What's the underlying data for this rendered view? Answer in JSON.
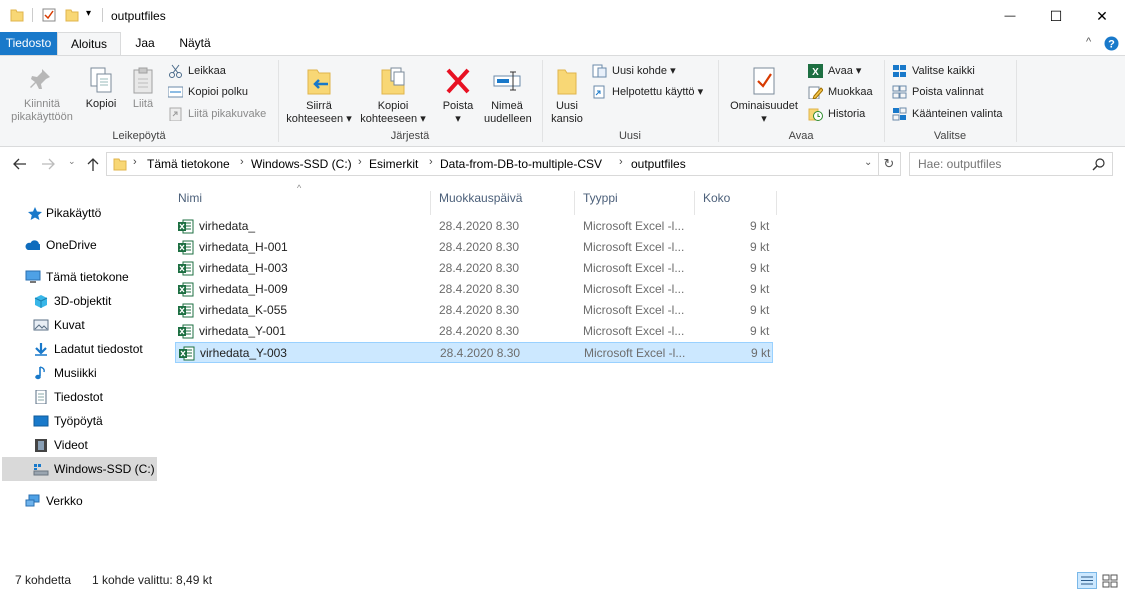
{
  "window": {
    "title": "outputfiles",
    "minimize": "—",
    "maximize": "☐",
    "close": "✕"
  },
  "ribbon_tabs": [
    "Tiedosto",
    "Aloitus",
    "Jaa",
    "Näytä"
  ],
  "ribbon": {
    "clipboard": {
      "label": "Leikepöytä",
      "pin": "Kiinnitä pikakäyttöön",
      "copy": "Kopioi",
      "paste": "Liitä",
      "cut": "Leikkaa",
      "copy_path": "Kopioi polku",
      "paste_shortcut": "Liitä pikakuvake"
    },
    "organize": {
      "label": "Järjestä",
      "move_to": "Siirrä kohteeseen",
      "copy_to": "Kopioi kohteeseen",
      "delete": "Poista",
      "rename": "Nimeä uudelleen"
    },
    "new": {
      "label": "Uusi",
      "new_folder": "Uusi kansio",
      "new_item": "Uusi kohde",
      "easy_access": "Helpotettu käyttö"
    },
    "open": {
      "label": "Avaa",
      "properties": "Ominaisuudet",
      "open": "Avaa",
      "edit": "Muokkaa",
      "history": "Historia"
    },
    "select": {
      "label": "Valitse",
      "select_all": "Valitse kaikki",
      "select_none": "Poista valinnat",
      "invert": "Käänteinen valinta"
    }
  },
  "address": {
    "crumbs": [
      "Tämä tietokone",
      "Windows-SSD (C:)",
      "Esimerkit",
      "Data-from-DB-to-multiple-CSV",
      "outputfiles"
    ],
    "search_placeholder": "Hae: outputfiles"
  },
  "nav_pane": {
    "quick_access": "Pikakäyttö",
    "onedrive": "OneDrive",
    "this_pc": "Tämä tietokone",
    "items": [
      "3D-objektit",
      "Kuvat",
      "Ladatut tiedostot",
      "Musiikki",
      "Tiedostot",
      "Työpöytä",
      "Videot",
      "Windows-SSD (C:)"
    ],
    "network": "Verkko"
  },
  "columns": [
    "Nimi",
    "Muokkauspäivä",
    "Tyyppi",
    "Koko"
  ],
  "files": [
    {
      "name": "virhedata_",
      "date": "28.4.2020 8.30",
      "type": "Microsoft Excel -l...",
      "size": "9 kt"
    },
    {
      "name": "virhedata_H-001",
      "date": "28.4.2020 8.30",
      "type": "Microsoft Excel -l...",
      "size": "9 kt"
    },
    {
      "name": "virhedata_H-003",
      "date": "28.4.2020 8.30",
      "type": "Microsoft Excel -l...",
      "size": "9 kt"
    },
    {
      "name": "virhedata_H-009",
      "date": "28.4.2020 8.30",
      "type": "Microsoft Excel -l...",
      "size": "9 kt"
    },
    {
      "name": "virhedata_K-055",
      "date": "28.4.2020 8.30",
      "type": "Microsoft Excel -l...",
      "size": "9 kt"
    },
    {
      "name": "virhedata_Y-001",
      "date": "28.4.2020 8.30",
      "type": "Microsoft Excel -l...",
      "size": "9 kt"
    },
    {
      "name": "virhedata_Y-003",
      "date": "28.4.2020 8.30",
      "type": "Microsoft Excel -l...",
      "size": "9 kt"
    }
  ],
  "status": {
    "count": "7 kohdetta",
    "selected": "1 kohde valittu: 8,49 kt"
  },
  "colors": {
    "accent": "#1979ca",
    "selection": "#cce8ff",
    "excel_green": "#1d6f42",
    "folder_yellow": "#f8d775"
  }
}
